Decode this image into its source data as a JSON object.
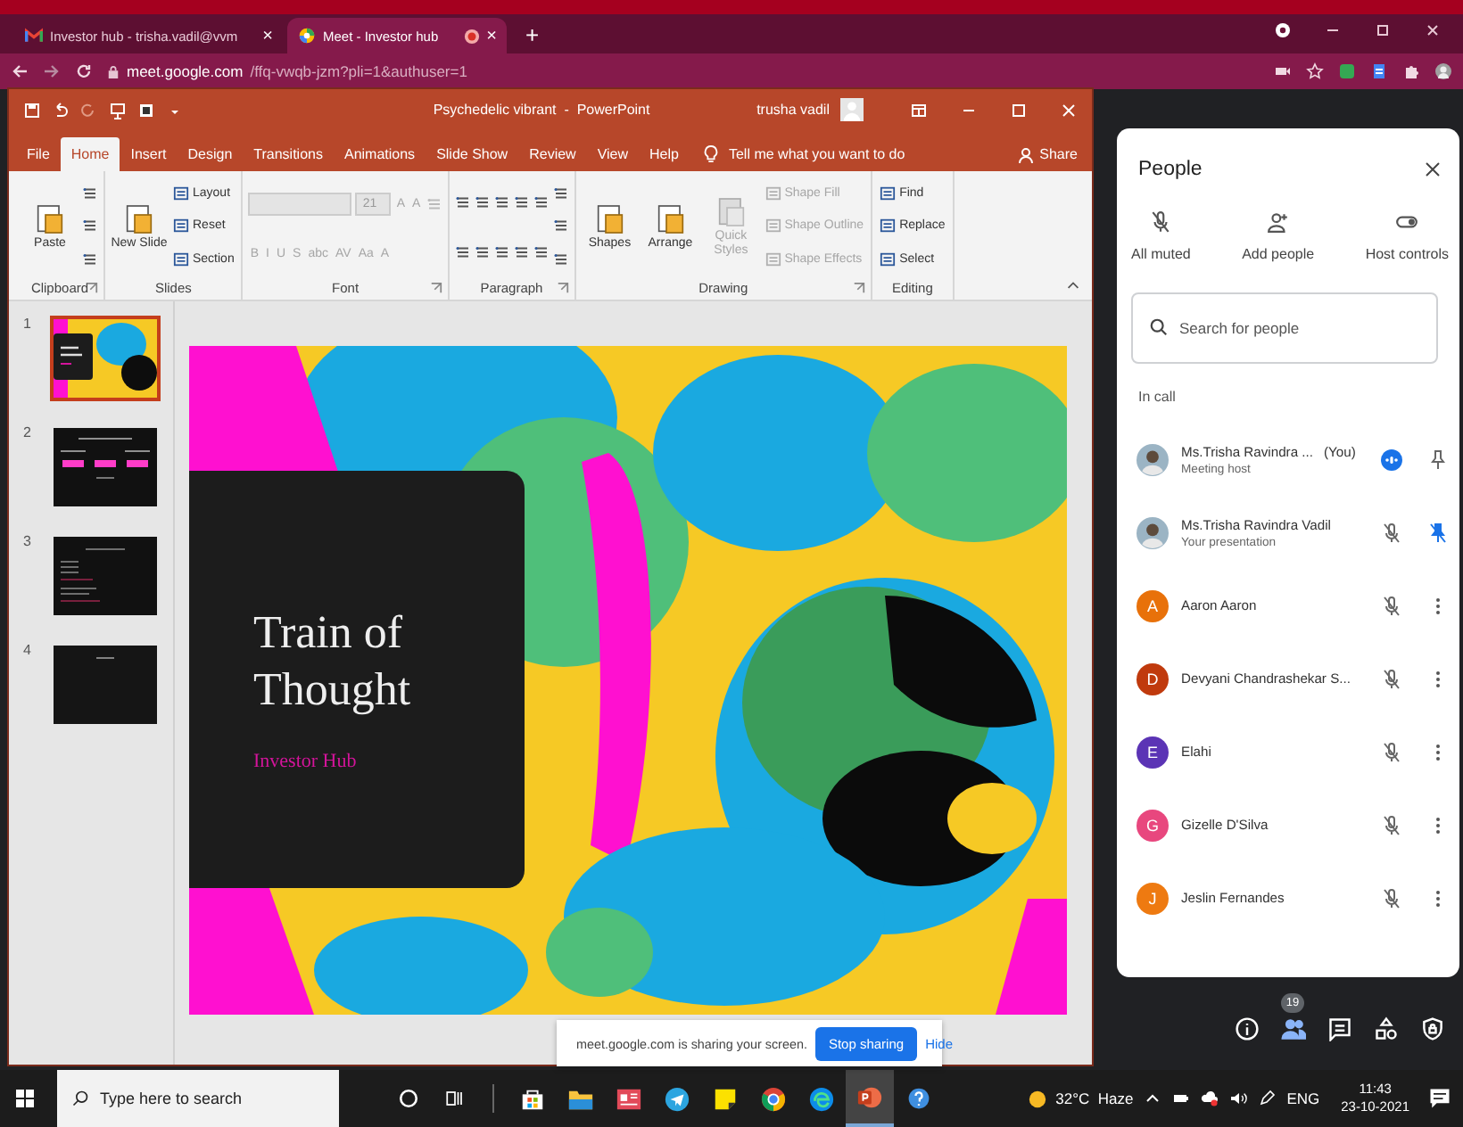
{
  "browser": {
    "tabs": [
      {
        "title": "Investor hub - trisha.vadil@vvm",
        "kind": "mail",
        "selected": false,
        "recording": false,
        "close": "×"
      },
      {
        "title": "Meet - Investor hub",
        "kind": "meet",
        "selected": true,
        "recording": true,
        "close": "×"
      }
    ],
    "new_tab": "+",
    "url_host": "meet.google.com",
    "url_path": "/ffq-vwqb-jzm?pli=1&authuser=1"
  },
  "powerpoint": {
    "title": "Psychedelic vibrant  -  PowerPoint",
    "user": "trusha vadil",
    "tabs": [
      {
        "label": "File",
        "selected": false
      },
      {
        "label": "Home",
        "selected": true
      },
      {
        "label": "Insert",
        "selected": false
      },
      {
        "label": "Design",
        "selected": false
      },
      {
        "label": "Transitions",
        "selected": false
      },
      {
        "label": "Animations",
        "selected": false
      },
      {
        "label": "Slide Show",
        "selected": false
      },
      {
        "label": "Review",
        "selected": false
      },
      {
        "label": "View",
        "selected": false
      },
      {
        "label": "Help",
        "selected": false
      }
    ],
    "tell_me": "Tell me what you want to do",
    "share": "Share",
    "ribbon": [
      {
        "label": "Clipboard",
        "launcher": true,
        "columns": [
          [
            {
              "kind": "large",
              "label": "Paste",
              "disabled": false
            }
          ],
          [
            {
              "kind": "icon",
              "disabled": false
            },
            {
              "kind": "icon",
              "disabled": false
            },
            {
              "kind": "icon",
              "disabled": false
            }
          ]
        ]
      },
      {
        "label": "Slides",
        "launcher": false,
        "columns": [
          [
            {
              "kind": "large",
              "label": "New Slide",
              "disabled": false
            }
          ],
          [
            {
              "kind": "small",
              "label": "Layout",
              "disabled": false
            },
            {
              "kind": "small",
              "label": "Reset",
              "disabled": false
            },
            {
              "kind": "small",
              "label": "Section",
              "disabled": false
            }
          ]
        ]
      },
      {
        "label": "Font",
        "launcher": true,
        "columns": [
          [
            {
              "kind": "row",
              "items": [
                {
                  "kind": "fontbox",
                  "disabled": true
                },
                {
                  "kind": "sizebox",
                  "value": "21",
                  "disabled": true
                },
                {
                  "kind": "format",
                  "label": "A",
                  "disabled": true
                },
                {
                  "kind": "format",
                  "label": "A",
                  "disabled": true
                },
                {
                  "kind": "icon",
                  "disabled": true
                }
              ]
            },
            {
              "kind": "row",
              "items": [
                {
                  "kind": "format",
                  "label": "B",
                  "disabled": true
                },
                {
                  "kind": "format",
                  "label": "I",
                  "disabled": true
                },
                {
                  "kind": "format",
                  "label": "U",
                  "disabled": true
                },
                {
                  "kind": "format",
                  "label": "S",
                  "disabled": true
                },
                {
                  "kind": "format",
                  "label": "abc",
                  "disabled": true
                },
                {
                  "kind": "format",
                  "label": "AV",
                  "disabled": true
                },
                {
                  "kind": "format",
                  "label": "Aa",
                  "disabled": true
                },
                {
                  "kind": "format",
                  "label": "A",
                  "disabled": true
                }
              ]
            }
          ]
        ]
      },
      {
        "label": "Paragraph",
        "launcher": true,
        "columns": [
          [
            {
              "kind": "row",
              "items": [
                {
                  "kind": "icon",
                  "disabled": false
                },
                {
                  "kind": "icon",
                  "disabled": false
                },
                {
                  "kind": "icon",
                  "disabled": false
                },
                {
                  "kind": "icon",
                  "disabled": false
                },
                {
                  "kind": "icon",
                  "disabled": false
                }
              ]
            },
            {
              "kind": "row",
              "items": [
                {
                  "kind": "icon",
                  "disabled": false
                },
                {
                  "kind": "icon",
                  "disabled": false
                },
                {
                  "kind": "icon",
                  "disabled": false
                },
                {
                  "kind": "icon",
                  "disabled": false
                },
                {
                  "kind": "icon",
                  "disabled": false
                }
              ]
            }
          ],
          [
            {
              "kind": "icon",
              "disabled": false
            },
            {
              "kind": "icon",
              "disabled": false
            },
            {
              "kind": "icon",
              "disabled": false
            }
          ]
        ]
      },
      {
        "label": "Drawing",
        "launcher": true,
        "columns": [
          [
            {
              "kind": "large",
              "label": "Shapes",
              "disabled": false
            }
          ],
          [
            {
              "kind": "large",
              "label": "Arrange",
              "disabled": false
            }
          ],
          [
            {
              "kind": "large",
              "label": "Quick Styles",
              "disabled": true
            }
          ],
          [
            {
              "kind": "small",
              "label": "Shape Fill",
              "disabled": true
            },
            {
              "kind": "small",
              "label": "Shape Outline",
              "disabled": true
            },
            {
              "kind": "small",
              "label": "Shape Effects",
              "disabled": true
            }
          ]
        ]
      },
      {
        "label": "Editing",
        "launcher": false,
        "columns": [
          [
            {
              "kind": "small",
              "label": "Find",
              "disabled": false
            },
            {
              "kind": "small",
              "label": "Replace",
              "disabled": false
            },
            {
              "kind": "small",
              "label": "Select",
              "disabled": false
            }
          ]
        ]
      }
    ],
    "slides": [
      {
        "number": "1",
        "kind": "title",
        "selected": true
      },
      {
        "number": "2",
        "kind": "diagram",
        "selected": false
      },
      {
        "number": "3",
        "kind": "bullets",
        "selected": false
      },
      {
        "number": "4",
        "kind": "blank",
        "selected": false
      }
    ],
    "slide": {
      "title": "Train of Thought",
      "subtitle": "Investor Hub"
    }
  },
  "share_banner": {
    "message": "meet.google.com is sharing your screen.",
    "stop": "Stop sharing",
    "hide": "Hide"
  },
  "people": {
    "title": "People",
    "actions": [
      {
        "kind": "mute",
        "label": "All muted"
      },
      {
        "kind": "add",
        "label": "Add people"
      },
      {
        "kind": "host",
        "label": "Host controls"
      }
    ],
    "search": {
      "placeholder": "Search for people"
    },
    "section": "In call",
    "participants": [
      {
        "kind": "host",
        "name": "Ms.Trisha Ravindra ...",
        "tag": "(You)",
        "subtitle": "Meeting host",
        "speaking": true,
        "pinned": false
      },
      {
        "kind": "host",
        "name": "Ms.Trisha Ravindra Vadil",
        "subtitle": "Your presentation",
        "speaking": false,
        "pinned": true
      },
      {
        "kind": "guest",
        "name": "Aaron Aaron",
        "initial": "A",
        "color": "#e8710a",
        "speaking": false
      },
      {
        "kind": "guest",
        "name": "Devyani Chandrashekar S...",
        "initial": "D",
        "color": "#c03a0d",
        "speaking": false
      },
      {
        "kind": "guest",
        "name": "Elahi",
        "initial": "E",
        "color": "#5b34b5",
        "speaking": false
      },
      {
        "kind": "guest",
        "name": "Gizelle D'Silva",
        "initial": "G",
        "color": "#e8477e",
        "speaking": false
      },
      {
        "kind": "guest",
        "name": "Jeslin Fernandes",
        "initial": "J",
        "color": "#ee7a11",
        "speaking": false
      }
    ]
  },
  "meet_controls": [
    {
      "kind": "info",
      "selected": false
    },
    {
      "kind": "people",
      "selected": true,
      "badge": "19"
    },
    {
      "kind": "chat",
      "selected": false
    },
    {
      "kind": "activities",
      "selected": false
    },
    {
      "kind": "safety",
      "selected": false
    }
  ],
  "taskbar": {
    "search": {
      "placeholder": "Type here to search"
    },
    "apps": [
      {
        "kind": "store",
        "active": false
      },
      {
        "kind": "explorer",
        "active": false
      },
      {
        "kind": "news",
        "active": false
      },
      {
        "kind": "telegram",
        "active": false
      },
      {
        "kind": "notes",
        "active": false
      },
      {
        "kind": "chrome",
        "active": false
      },
      {
        "kind": "edge",
        "active": false
      },
      {
        "kind": "powerpoint",
        "active": true
      }
    ],
    "weather": "32°C  Haze",
    "language": "ENG",
    "time": "11:43",
    "date": "23-10-2021"
  }
}
